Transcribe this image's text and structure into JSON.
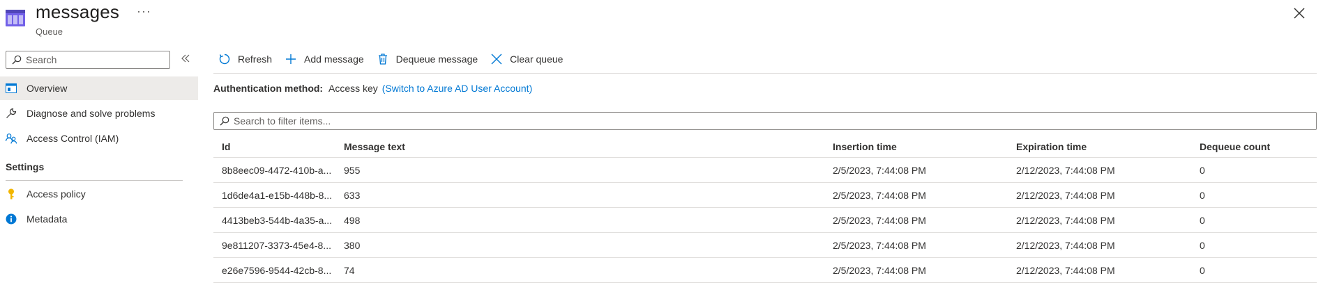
{
  "header": {
    "title": "messages",
    "subtitle": "Queue",
    "more": "···"
  },
  "sidebar": {
    "search_placeholder": "Search",
    "items": [
      {
        "label": "Overview",
        "icon": "overview-icon"
      },
      {
        "label": "Diagnose and solve problems",
        "icon": "wrench-icon"
      },
      {
        "label": "Access Control (IAM)",
        "icon": "people-icon"
      }
    ],
    "section": "Settings",
    "settings_items": [
      {
        "label": "Access policy",
        "icon": "key-icon"
      },
      {
        "label": "Metadata",
        "icon": "info-icon"
      }
    ]
  },
  "toolbar": {
    "refresh": "Refresh",
    "add_message": "Add message",
    "dequeue_message": "Dequeue message",
    "clear_queue": "Clear queue"
  },
  "auth": {
    "label": "Authentication method:",
    "value": "Access key",
    "link": "(Switch to Azure AD User Account)"
  },
  "filter": {
    "placeholder": "Search to filter items..."
  },
  "table": {
    "columns": [
      "Id",
      "Message text",
      "Insertion time",
      "Expiration time",
      "Dequeue count"
    ],
    "rows": [
      {
        "id": "8b8eec09-4472-410b-a...",
        "message": "955",
        "insertion": "2/5/2023, 7:44:08 PM",
        "expiration": "2/12/2023, 7:44:08 PM",
        "dequeue": "0"
      },
      {
        "id": "1d6de4a1-e15b-448b-8...",
        "message": "633",
        "insertion": "2/5/2023, 7:44:08 PM",
        "expiration": "2/12/2023, 7:44:08 PM",
        "dequeue": "0"
      },
      {
        "id": "4413beb3-544b-4a35-a...",
        "message": "498",
        "insertion": "2/5/2023, 7:44:08 PM",
        "expiration": "2/12/2023, 7:44:08 PM",
        "dequeue": "0"
      },
      {
        "id": "9e811207-3373-45e4-8...",
        "message": "380",
        "insertion": "2/5/2023, 7:44:08 PM",
        "expiration": "2/12/2023, 7:44:08 PM",
        "dequeue": "0"
      },
      {
        "id": "e26e7596-9544-42cb-8...",
        "message": "74",
        "insertion": "2/5/2023, 7:44:08 PM",
        "expiration": "2/12/2023, 7:44:08 PM",
        "dequeue": "0"
      }
    ]
  },
  "colors": {
    "accent": "#0078d4",
    "queue_icon": "#7160e8",
    "key_icon": "#f2b600"
  }
}
